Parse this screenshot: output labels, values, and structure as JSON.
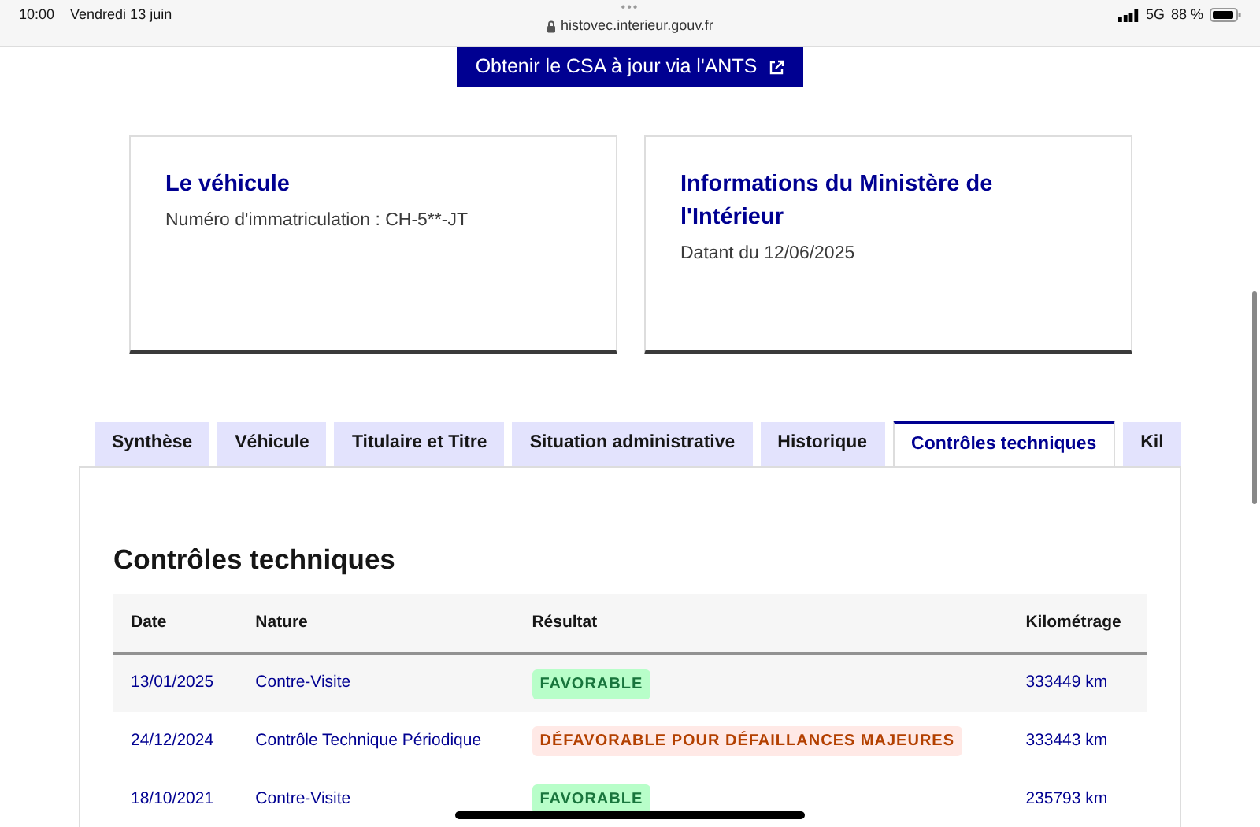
{
  "status_bar": {
    "time": "10:00",
    "date": "Vendredi 13 juin",
    "dots": "•••",
    "url": "histovec.interieur.gouv.fr",
    "network": "5G",
    "battery": "88 %"
  },
  "csa_button": "Obtenir le CSA à jour via l'ANTS",
  "cards": [
    {
      "title": "Le véhicule",
      "text": "Numéro d'immatriculation : CH-5**-JT"
    },
    {
      "title": "Informations du Ministère de l'Intérieur",
      "text": "Datant du 12/06/2025"
    }
  ],
  "tabs": [
    {
      "label": "Synthèse",
      "selected": false
    },
    {
      "label": "Véhicule",
      "selected": false
    },
    {
      "label": "Titulaire et Titre",
      "selected": false
    },
    {
      "label": "Situation administrative",
      "selected": false
    },
    {
      "label": "Historique",
      "selected": false
    },
    {
      "label": "Contrôles techniques",
      "selected": true
    },
    {
      "label": "Kil",
      "selected": false
    }
  ],
  "section_title": "Contrôles techniques",
  "table": {
    "columns": [
      "Date",
      "Nature",
      "Résultat",
      "Kilométrage"
    ],
    "rows": [
      {
        "date": "13/01/2025",
        "nature": "Contre-Visite",
        "result": {
          "label": "FAVORABLE",
          "kind": "success"
        },
        "km": "333449 km"
      },
      {
        "date": "24/12/2024",
        "nature": "Contrôle Technique Périodique",
        "result": {
          "label": "DÉFAVORABLE POUR DÉFAILLANCES MAJEURES",
          "kind": "error"
        },
        "km": "333443 km"
      },
      {
        "date": "18/10/2021",
        "nature": "Contre-Visite",
        "result": {
          "label": "FAVORABLE",
          "kind": "success"
        },
        "km": "235793 km"
      }
    ]
  }
}
